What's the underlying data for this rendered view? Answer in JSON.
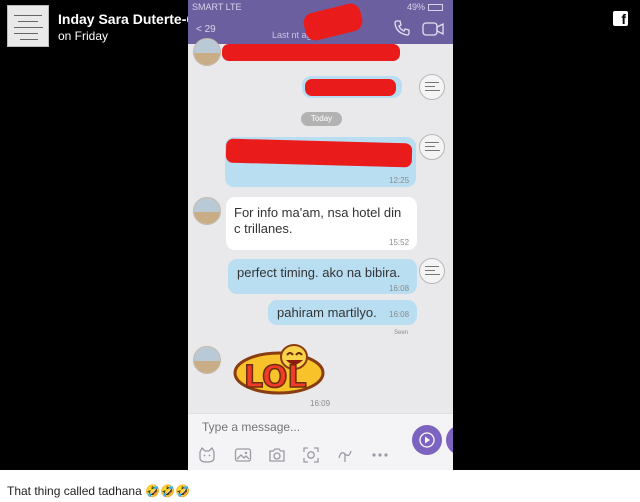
{
  "post": {
    "author": "Inday Sara Duterte-Carpio",
    "verified_mark": "✔",
    "time": "on Friday",
    "caption": "That thing called tadhana 🤣🤣🤣",
    "facebook_mark": "f"
  },
  "screenshot": {
    "status_bar": {
      "carrier": "SMART  LTE",
      "battery": "49%"
    },
    "header": {
      "back_label": "< 29",
      "last_seen": "Last                    nt ago",
      "icons": [
        "phone-icon",
        "video-call-icon"
      ]
    },
    "date_divider": "Today",
    "messages": [
      {
        "direction": "in",
        "text_lines": [
          "For info ma'am, nsa hotel din",
          "c trillanes."
        ],
        "time": "15:52"
      },
      {
        "direction": "out",
        "text_lines": [
          "perfect timing. ako na bibira."
        ],
        "time": "16:08"
      },
      {
        "direction": "out",
        "text_lines": [
          "pahiram martilyo."
        ],
        "time": "16:08"
      }
    ],
    "redacted_time": "12:25",
    "seen_label": "Seen",
    "sticker": {
      "text": "LOL",
      "time": "16:09"
    },
    "composer": {
      "placeholder": "Type a message...",
      "tray_icons": [
        "sticker-icon",
        "gallery-icon",
        "camera-icon",
        "gif-icon",
        "doodle-icon",
        "more-icon"
      ]
    },
    "colors": {
      "header": "#6c5f9f",
      "outgoing_bubble": "#b9def2",
      "incoming_bubble": "#ffffff",
      "redaction": "#ea1b1b",
      "send_button": "#7b63bf"
    }
  }
}
